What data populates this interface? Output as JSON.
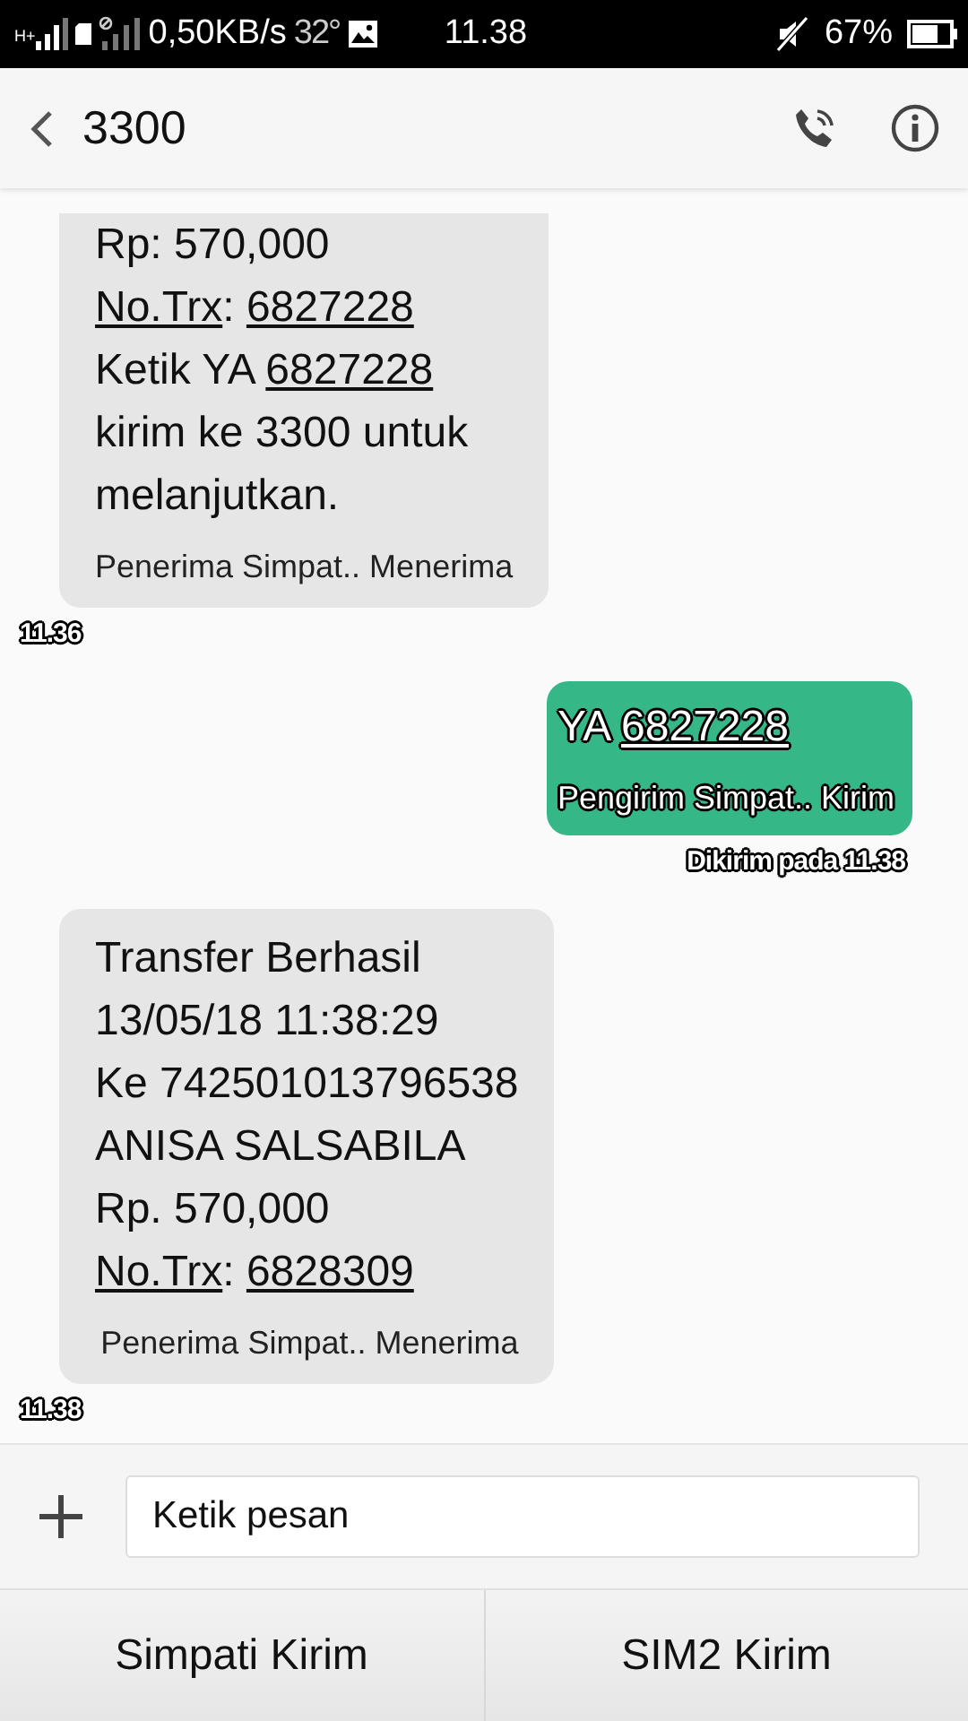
{
  "status_bar": {
    "network": "H+",
    "speed": "0,50KB/s",
    "temperature": "32°",
    "time": "11.38",
    "battery": "67%"
  },
  "header": {
    "title": "3300"
  },
  "messages": [
    {
      "kind": "incoming",
      "continued": true,
      "lines": [
        [
          {
            "text": "Rp: 570,000",
            "link": false
          }
        ],
        [
          {
            "text": "No.Trx",
            "link": true
          },
          {
            "text": ": ",
            "link": false
          },
          {
            "text": "6827228",
            "link": true
          }
        ],
        [
          {
            "text": "Ketik YA ",
            "link": false
          },
          {
            "text": "6827228",
            "link": true
          }
        ],
        [
          {
            "text": "kirim ke 3300 untuk",
            "link": false
          }
        ],
        [
          {
            "text": "melanjutkan.",
            "link": false
          }
        ]
      ],
      "sim": "Penerima Simpat.. Menerima",
      "time": "11.36"
    },
    {
      "kind": "outgoing",
      "continued": false,
      "lines": [
        [
          {
            "text": "YA ",
            "link": false
          },
          {
            "text": "6827228",
            "link": true
          }
        ]
      ],
      "sim": "Pengirim Simpat.. Kirim",
      "time": "Dikirim pada 11.38"
    },
    {
      "kind": "incoming",
      "continued": false,
      "lines": [
        [
          {
            "text": "Transfer Berhasil",
            "link": false
          }
        ],
        [
          {
            "text": "13/05/18 11:38:29",
            "link": false
          }
        ],
        [
          {
            "text": "Ke 742501013796538",
            "link": false
          }
        ],
        [
          {
            "text": "ANISA SALSABILA",
            "link": false
          }
        ],
        [
          {
            "text": "Rp. 570,000",
            "link": false
          }
        ],
        [
          {
            "text": "No.Trx",
            "link": true
          },
          {
            "text": ": ",
            "link": false
          },
          {
            "text": "6828309",
            "link": true
          }
        ]
      ],
      "sim": "Penerima Simpat.. Menerima",
      "time": "11.38"
    }
  ],
  "composer": {
    "placeholder": "Ketik pesan"
  },
  "send_buttons": [
    "Simpati Kirim",
    "SIM2 Kirim"
  ]
}
